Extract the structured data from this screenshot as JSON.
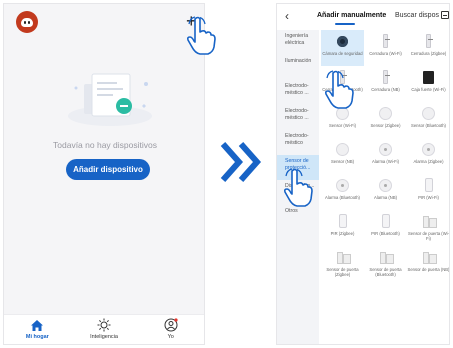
{
  "left_screen": {
    "empty_message": "Todavía no hay dispositivos",
    "add_device_button": "Añadir dispositivo",
    "plus_symbol": "+",
    "tabs": [
      {
        "label": "Mi hogar",
        "icon": "home-icon",
        "active": true
      },
      {
        "label": "Inteligencia",
        "icon": "sun-icon",
        "active": false
      },
      {
        "label": "Yo",
        "icon": "user-icon",
        "active": false
      }
    ]
  },
  "right_screen": {
    "back_symbol": "‹",
    "tab_manual": "Añadir manualmente",
    "tab_scan": "Buscar dispos",
    "categories": [
      {
        "label": "Ingeniería eléctrica",
        "active": false
      },
      {
        "label": "Iluminación",
        "active": false
      },
      {
        "label": "Electrodo-méstico ...",
        "active": false
      },
      {
        "label": "Electrodo-méstico ...",
        "active": false
      },
      {
        "label": "Electrodo-méstico",
        "active": false
      },
      {
        "label": "Sensor de protecció...",
        "active": true
      },
      {
        "label": "Dispositivo...",
        "active": false
      },
      {
        "label": "Otros",
        "active": false
      }
    ],
    "devices": [
      {
        "label": "Cámara de seguridad",
        "icon": "camera-icon",
        "selected": true
      },
      {
        "label": "Cerradura (Wi-Fi)",
        "icon": "lock-icon",
        "selected": false
      },
      {
        "label": "Cerradura (Zigbee)",
        "icon": "lock-icon",
        "selected": false
      },
      {
        "label": "Cerradura (Bluetooth)",
        "icon": "lock-icon",
        "selected": false
      },
      {
        "label": "Cerradura (NB)",
        "icon": "lock-icon",
        "selected": false
      },
      {
        "label": "Caja fuerte (Wi-Fi)",
        "icon": "safe-icon",
        "selected": false
      },
      {
        "label": "Sensor (Wi-Fi)",
        "icon": "sensor-icon",
        "selected": false
      },
      {
        "label": "Sensor (Zigbee)",
        "icon": "sensor-icon",
        "selected": false
      },
      {
        "label": "Sensor (Bluetooth)",
        "icon": "sensor-icon",
        "selected": false
      },
      {
        "label": "Sensor (NB)",
        "icon": "sensor-icon",
        "selected": false
      },
      {
        "label": "Alarma (Wi-Fi)",
        "icon": "alarm-icon",
        "selected": false
      },
      {
        "label": "Alarma (Zigbee)",
        "icon": "alarm-icon",
        "selected": false
      },
      {
        "label": "Alarma (Bluetooth)",
        "icon": "alarm-icon",
        "selected": false
      },
      {
        "label": "Alarma (NB)",
        "icon": "alarm-icon",
        "selected": false
      },
      {
        "label": "PIR (Wi-Fi)",
        "icon": "pir-icon",
        "selected": false
      },
      {
        "label": "PIR (Zigbee)",
        "icon": "pir-icon",
        "selected": false
      },
      {
        "label": "PIR (Bluetooth)",
        "icon": "pir-icon",
        "selected": false
      },
      {
        "label": "Sensor de puerta (Wi-Fi)",
        "icon": "door-sensor-icon",
        "selected": false
      },
      {
        "label": "Sensor de puerta (Zigbee)",
        "icon": "door-sensor-icon",
        "selected": false
      },
      {
        "label": "Sensor de puerta (Bluetooth)",
        "icon": "door-sensor-icon",
        "selected": false
      },
      {
        "label": "Sensor de puerta (NB)",
        "icon": "door-sensor-icon",
        "selected": false
      }
    ]
  },
  "colors": {
    "accent": "#1763c6",
    "selection": "#d9ebfa",
    "avatar": "#c23a1e"
  }
}
